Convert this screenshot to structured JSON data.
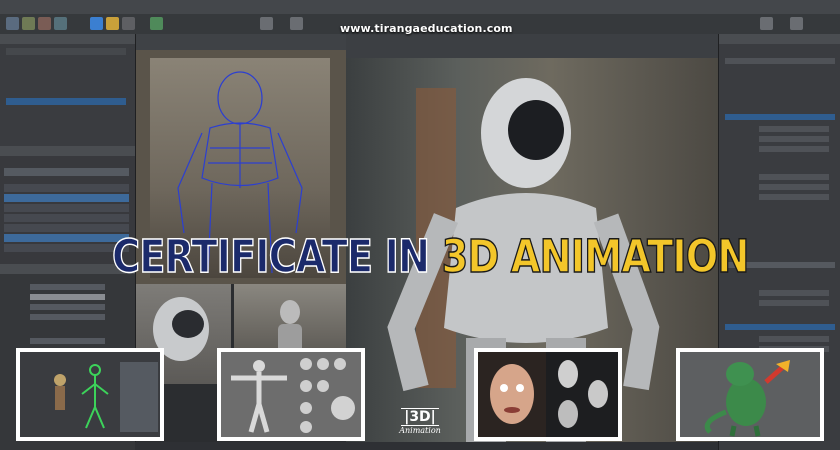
{
  "header": {
    "url": "www.tirangaeducation.com"
  },
  "title": {
    "part1": "CERTIFICATE IN",
    "part2": "3D ANIMATION"
  },
  "logo": {
    "mark": "|3D|",
    "word": "Animation"
  },
  "colors": {
    "title_navy": "#1b2a6b",
    "title_gold": "#f3c62a",
    "accent_blue": "#3b7fd1"
  },
  "thumbnails": [
    {
      "name": "thumb-motion-capture"
    },
    {
      "name": "thumb-character-sheet"
    },
    {
      "name": "thumb-face-sculpt"
    },
    {
      "name": "thumb-creature-model"
    }
  ]
}
